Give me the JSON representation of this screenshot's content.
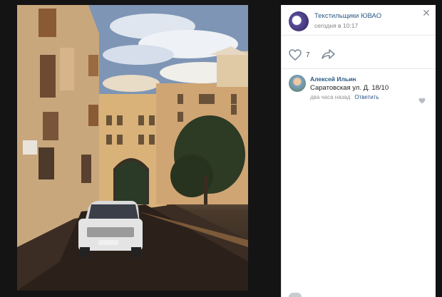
{
  "post": {
    "group_name": "Текстильщики ЮВАО",
    "time": "сегодня в 10:17",
    "likes": "7"
  },
  "comment": {
    "author": "Алексей Ильин",
    "text": "Саратовская ул. Д. 18/10",
    "time": "два часа назад",
    "reply_label": "Ответить"
  },
  "icons": {
    "close": "close-icon",
    "like": "heart-icon",
    "share": "share-arrow-icon"
  }
}
